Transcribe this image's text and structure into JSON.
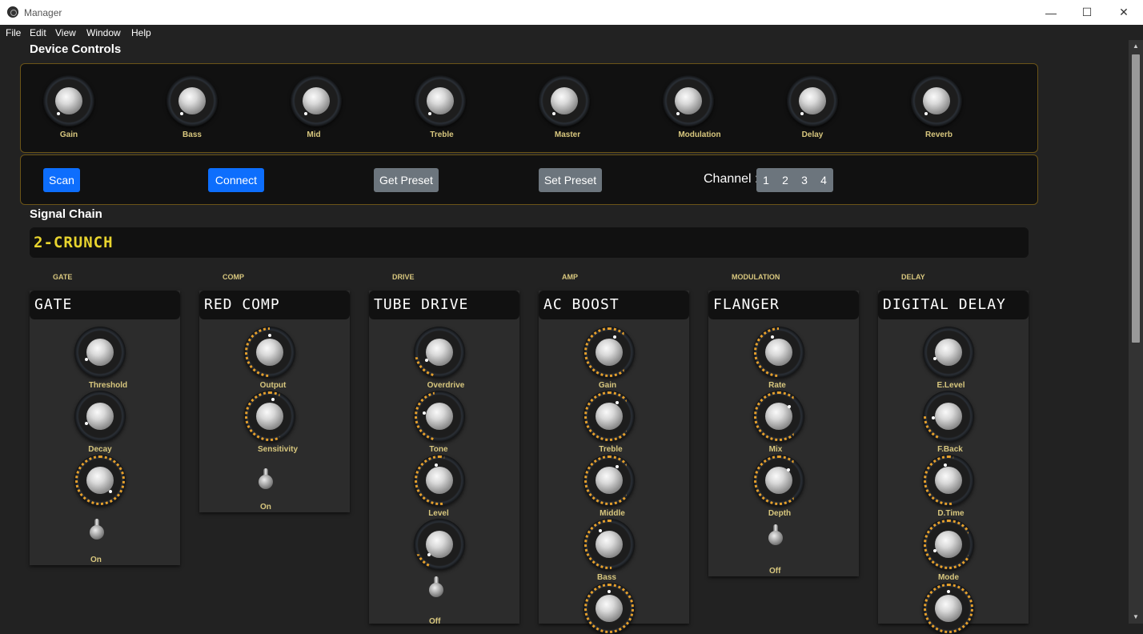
{
  "window": {
    "title": "Manager",
    "minimize": "—",
    "maximize": "☐",
    "close": "✕"
  },
  "menu": {
    "file": "File",
    "edit": "Edit",
    "view": "View",
    "window": "Window",
    "help": "Help"
  },
  "device_controls": {
    "title": "Device Controls",
    "knobs": [
      "Gain",
      "Bass",
      "Mid",
      "Treble",
      "Master",
      "Modulation",
      "Delay",
      "Reverb"
    ],
    "scan": "Scan",
    "connect": "Connect",
    "get_preset": "Get Preset",
    "set_preset": "Set Preset",
    "channel_label": "Channel :",
    "channels": [
      "1",
      "2",
      "3",
      "4"
    ]
  },
  "signal_chain": {
    "title": "Signal Chain",
    "preset_name": "2-CRUNCH",
    "categories": [
      "GATE",
      "COMP",
      "DRIVE",
      "AMP",
      "MODULATION",
      "DELAY"
    ],
    "pedals": [
      {
        "name": "GATE",
        "knobs": [
          "Threshold",
          "Decay"
        ],
        "switch": "On"
      },
      {
        "name": "RED COMP",
        "knobs": [
          "Output",
          "Sensitivity"
        ],
        "switch": "On"
      },
      {
        "name": "TUBE DRIVE",
        "knobs": [
          "Overdrive",
          "Tone",
          "Level"
        ],
        "switch": "Off"
      },
      {
        "name": "AC BOOST",
        "knobs": [
          "Gain",
          "Treble",
          "Middle",
          "Bass"
        ]
      },
      {
        "name": "FLANGER",
        "knobs": [
          "Rate",
          "Mix",
          "Depth"
        ],
        "switch": "Off"
      },
      {
        "name": "DIGITAL DELAY",
        "knobs": [
          "E.Level",
          "F.Back",
          "D.Time",
          "Mode"
        ]
      }
    ]
  },
  "colors": {
    "accent_blue": "#0d6efd",
    "secondary_gray": "#6c757d",
    "label_gold": "#d8c77e",
    "lcd_yellow": "#e8d42e",
    "border_gold": "#6b5418",
    "glow_orange": "#e6a02c"
  }
}
